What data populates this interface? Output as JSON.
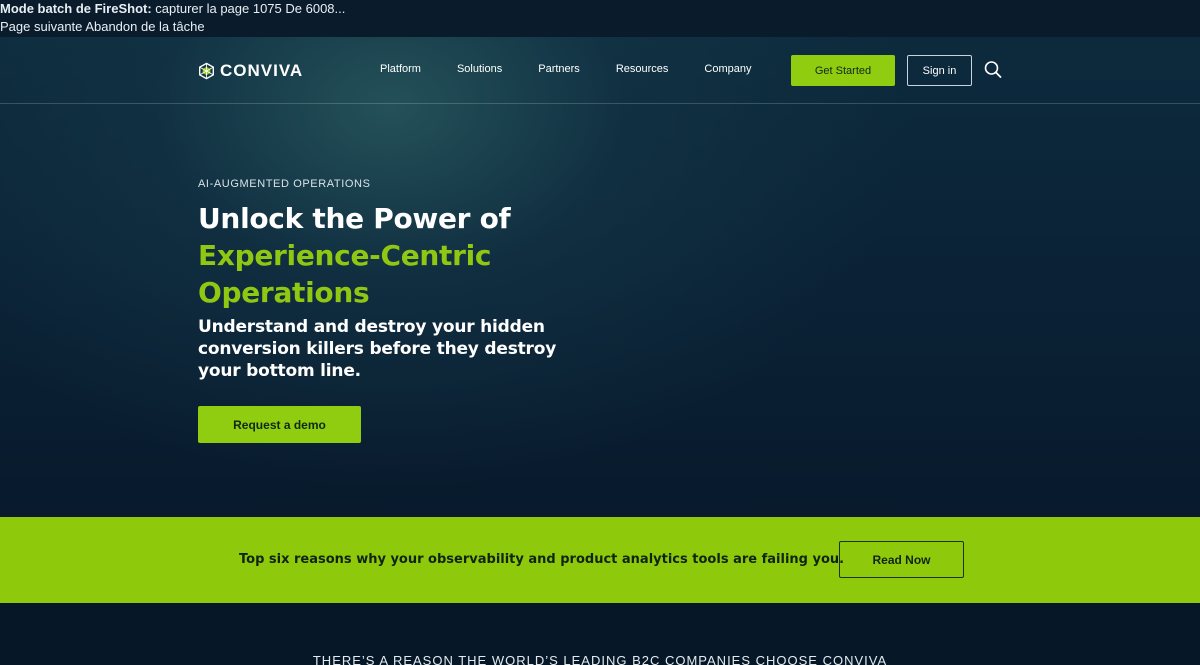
{
  "fireshot": {
    "title_bold": "Mode batch de FireShot:",
    "title_rest": " capturer la page 1075 De 6008...",
    "next_page": "Page suivante",
    "abort": "Abandon de la tâche"
  },
  "header": {
    "logo_text": "CONVIVA",
    "nav": [
      "Platform",
      "Solutions",
      "Partners",
      "Resources",
      "Company"
    ],
    "get_started": "Get Started",
    "sign_in": "Sign in"
  },
  "hero": {
    "eyebrow": "AI-AUGMENTED OPERATIONS",
    "headline_line1": "Unlock the Power of",
    "headline_accent1": "Experience-Centric",
    "headline_accent2": "Operations",
    "subhead": "Understand and destroy your hidden conversion killers before they destroy your bottom line.",
    "cta": "Request a demo"
  },
  "promo": {
    "text": "Top six reasons why your observability and product analytics tools are failing you.",
    "cta": "Read Now"
  },
  "bottom": {
    "reason": "THERE’S A REASON THE WORLD’S LEADING B2C COMPANIES CHOOSE CONVIVA"
  },
  "colors": {
    "accent": "#90cc10",
    "background": "#071a2b"
  }
}
